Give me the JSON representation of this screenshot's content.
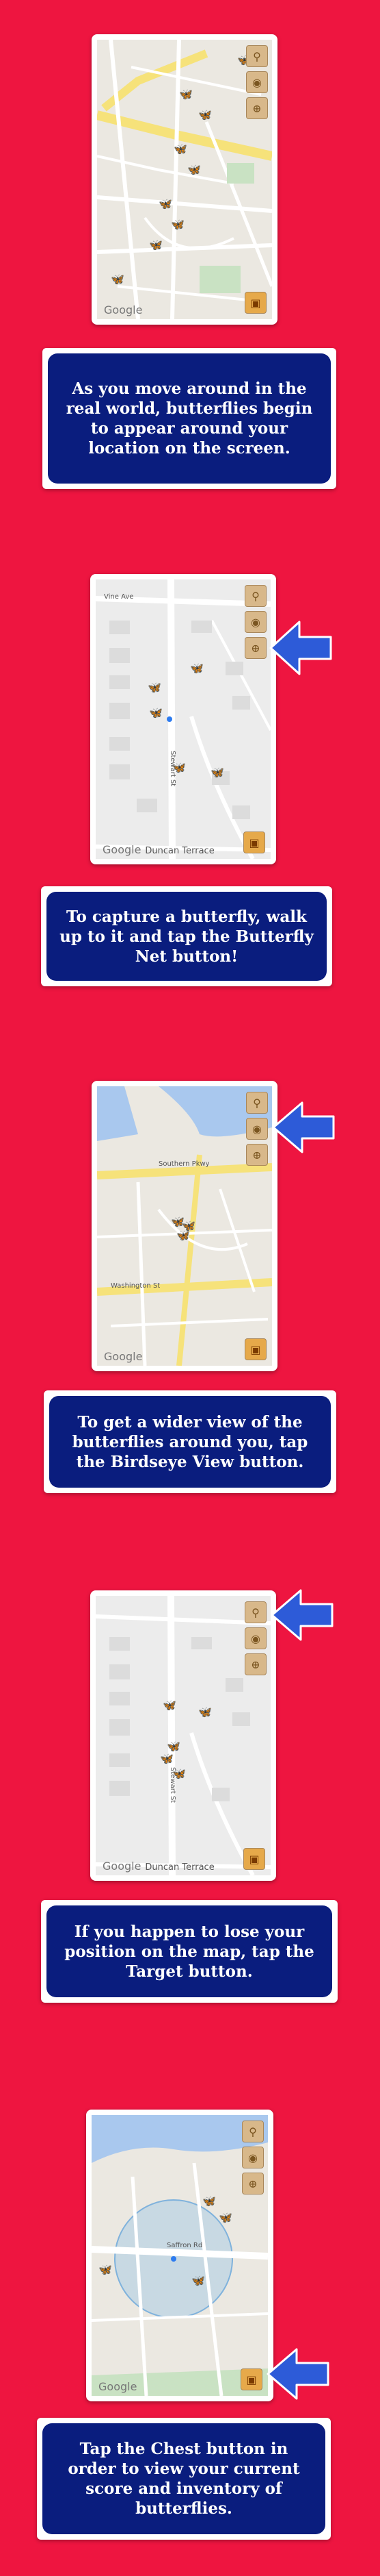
{
  "brand": {
    "map_watermark": "Google"
  },
  "steps": [
    {
      "caption": "As you move around in the real world, butterflies begin to appear around your location on the screen."
    },
    {
      "caption": "To capture a butterfly, walk up to it and tap the Butterfly Net button!",
      "map_streets": [
        "Vine Ave",
        "Stewart St",
        "Duncan Terrace"
      ]
    },
    {
      "caption": "To get a wider view of the butterflies around you, tap the Birdseye View button.",
      "map_streets": [
        "Southern Pkwy",
        "Washington St"
      ]
    },
    {
      "caption": "If you happen to lose your position on the map, tap the Target button.",
      "map_streets": [
        "Stewart St",
        "Duncan Terrace"
      ]
    },
    {
      "caption": "Tap the Chest button in order to view your current score and inventory of butterflies.",
      "map_streets": [
        "Saffron Rd"
      ]
    }
  ],
  "icons": {
    "butterfly_net": "net-icon",
    "birdseye": "eye-icon",
    "target": "target-icon",
    "chest": "chest-icon",
    "pointer": "arrow-left-icon"
  },
  "colors": {
    "background": "#ee1540",
    "caption_fill": "#0a1d7e",
    "arrow": "#2d5bd8"
  }
}
